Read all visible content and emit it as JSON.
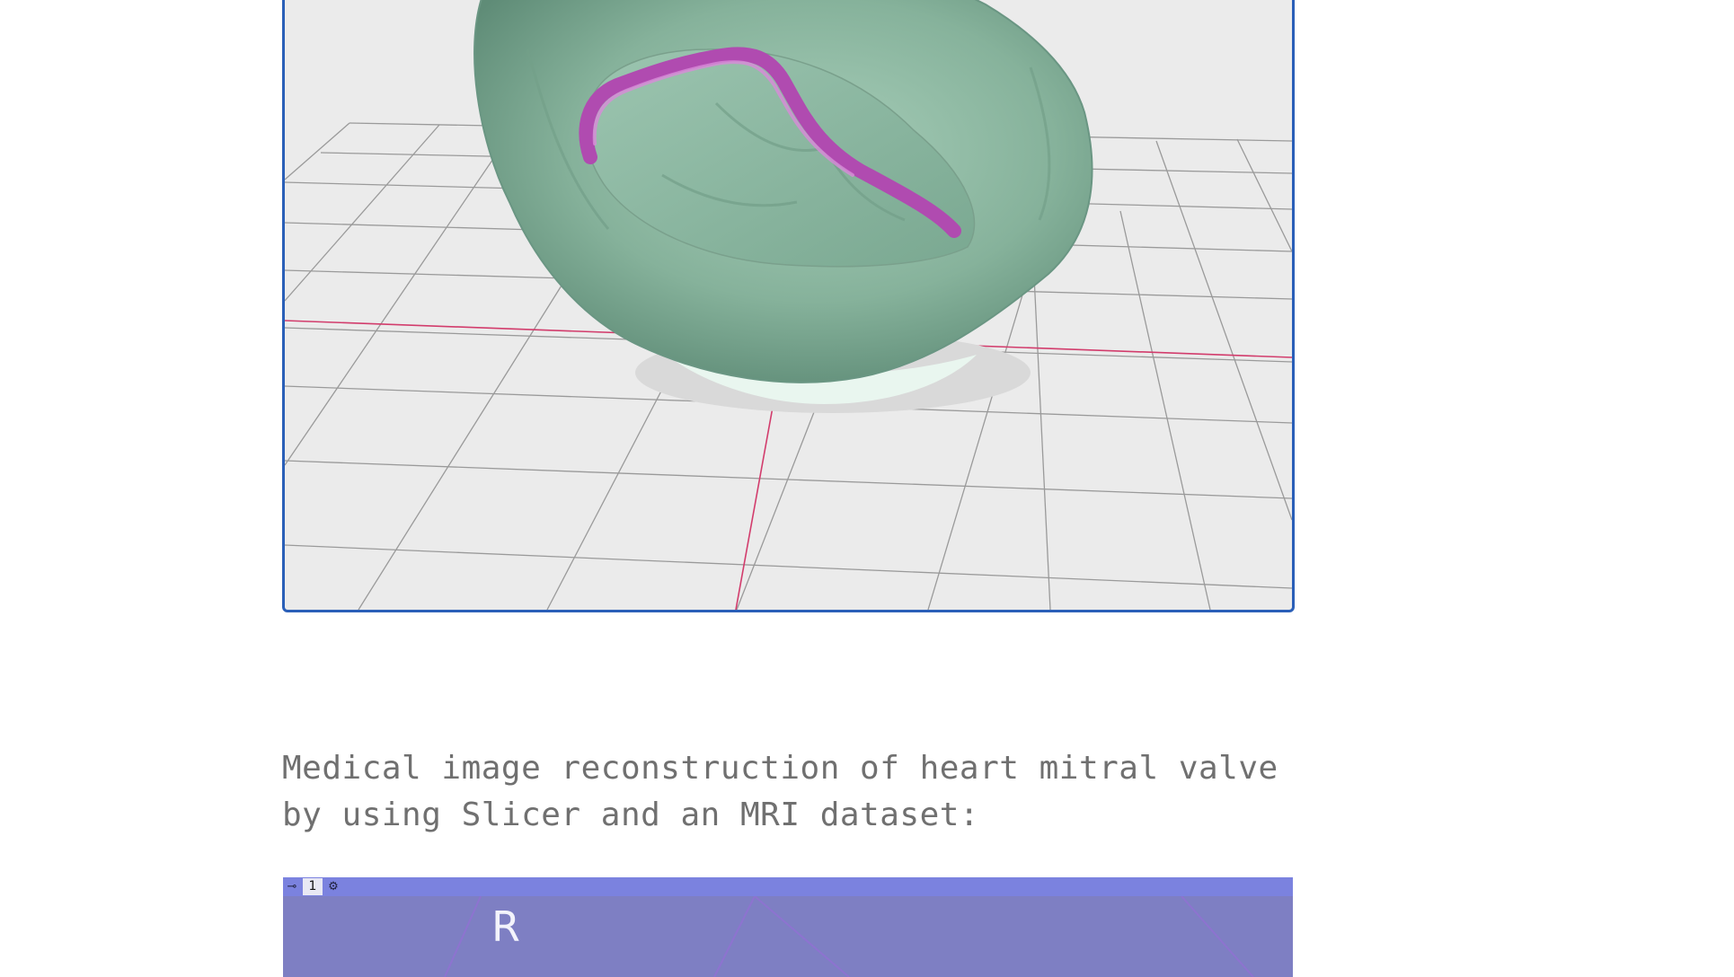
{
  "viewer3d": {
    "background": "#ebebeb",
    "border_color": "#2a5fb8",
    "model_color": "#8fb8a3",
    "curve_color": "#b04bb0",
    "axis_color": "#d23c6c"
  },
  "caption": {
    "text": "Medical image reconstruction of heart mitral valve by using Slicer and an MRI dataset:"
  },
  "slice_viewer": {
    "background": "#7e7fc3",
    "toolbar_color": "#7b82df",
    "pin_icon": "pin-icon",
    "slice_number": "1",
    "settings_icon": "gear-icon",
    "orientation_label": "R"
  }
}
